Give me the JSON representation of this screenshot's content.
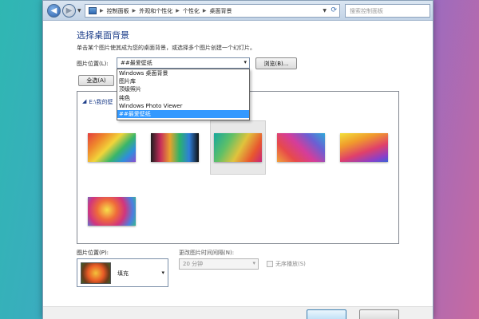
{
  "address_bar": {
    "breadcrumbs": [
      "控制面板",
      "外观和个性化",
      "个性化",
      "桌面背景"
    ]
  },
  "search": {
    "placeholder": "搜索控制面板"
  },
  "page": {
    "heading": "选择桌面背景",
    "subtext": "单击某个图片使其成为您的桌面背景，或选择多个图片创建一个幻灯片。"
  },
  "picture_location": {
    "label": "图片位置(L):",
    "selected": "##最爱壁纸",
    "options": [
      "Windows 桌面背景",
      "图片库",
      "顶级照片",
      "纯色",
      "Windows Photo Viewer",
      "##最爱壁纸"
    ],
    "browse_label": "浏览(B)..."
  },
  "select_all_label": "全选(A)",
  "gallery": {
    "group_header": "E:\\我的壁",
    "thumbnails": [
      "wallpaper-1",
      "wallpaper-2",
      "wallpaper-3",
      "wallpaper-4",
      "wallpaper-5",
      "wallpaper-6"
    ],
    "selected_index": 2
  },
  "picture_position": {
    "label": "图片位置(P):",
    "value": "填充"
  },
  "interval": {
    "label": "更改图片时间间隔(N):",
    "value": "20 分钟"
  },
  "shuffle": {
    "label": "无序播放(S)",
    "checked": false
  },
  "colors": {
    "selection": "#3399ff",
    "heading": "#1e3f8a"
  }
}
